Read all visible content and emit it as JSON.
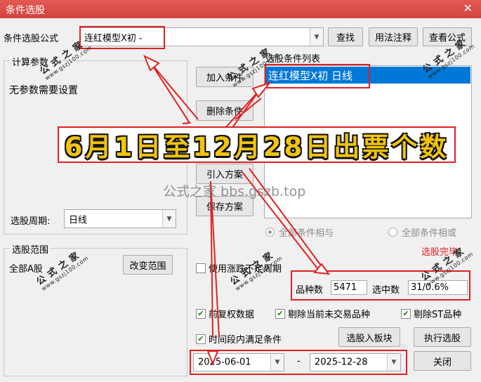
{
  "window": {
    "title": "条件选股",
    "close_glyph": "✕"
  },
  "formula": {
    "label": "条件选股公式",
    "value": "连红模型X初  -",
    "find_btn": "查找",
    "usage_btn": "用法注释",
    "view_btn": "查看公式"
  },
  "params": {
    "legend": "计算参数",
    "note": "无参数需要设置",
    "period_label": "选股周期:",
    "period_value": "日线"
  },
  "middle_buttons": {
    "add": "加入条件",
    "delete": "删除条件",
    "import": "引入方案",
    "save": "保存方案"
  },
  "conditions": {
    "label": "选股条件列表",
    "items": [
      "连红模型X初  日线"
    ]
  },
  "logic": {
    "and_label": "全部条件相与",
    "or_label": "全部条件相或",
    "and_selected": true
  },
  "scope": {
    "legend": "选股范围",
    "value": "全部A股",
    "change_btn": "改变范围"
  },
  "options": {
    "indefinite_period": "使用涨跌不定周期",
    "select_done": "选股完毕",
    "count_label": "品种数",
    "count_value": "5471",
    "selected_label": "选中数",
    "selected_value": "31/0.6%",
    "adjusted": "前复权数据",
    "exclude_untraded": "剔除当前未交易品种",
    "exclude_st": "剔除ST品种",
    "period_satisfy": "时间段内满足条件",
    "to_board_btn": "选股入板块",
    "run_btn": "执行选股",
    "close_btn": "关闭"
  },
  "date_range": {
    "start": "2025-06-01",
    "sep": "-",
    "end": "2025-12-28"
  },
  "overlay": {
    "banner": "6月1日至12月28日出票个数",
    "watermark": "公式之家 bbs.gszb.top",
    "stamp_main": "公式之家",
    "stamp_url": "www.gszj100.com"
  },
  "colors": {
    "title_bar": "#d9534f",
    "selection": "#0078d7",
    "annotation_red": "#e02020",
    "banner_text": "#f1c40f"
  }
}
